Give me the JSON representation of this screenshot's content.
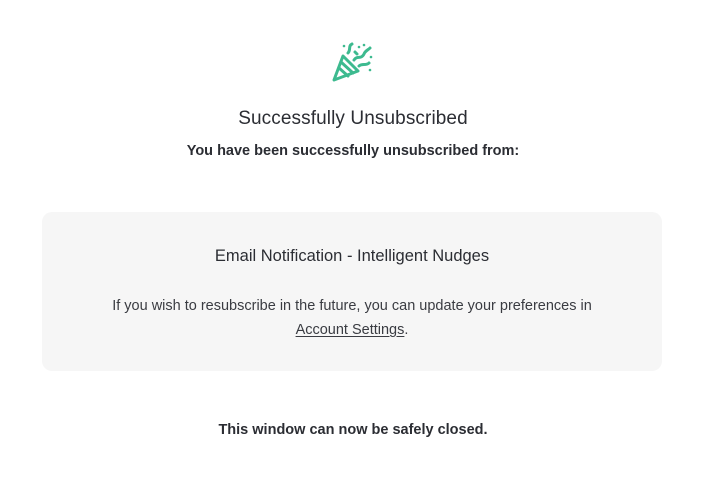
{
  "header": {
    "icon": "party-popper-icon",
    "title": "Successfully Unsubscribed",
    "subtitle": "You have been successfully unsubscribed from:"
  },
  "card": {
    "title": "Email Notification - Intelligent Nudges",
    "text_line1": "If you wish to resubscribe in the future, you can update your preferences in",
    "link_label": "Account Settings",
    "link_suffix": "."
  },
  "footer": {
    "note": "This window can now be safely closed."
  },
  "colors": {
    "accent": "#3dba8f",
    "text": "#2b2d33",
    "card_bg": "#f6f6f6"
  }
}
